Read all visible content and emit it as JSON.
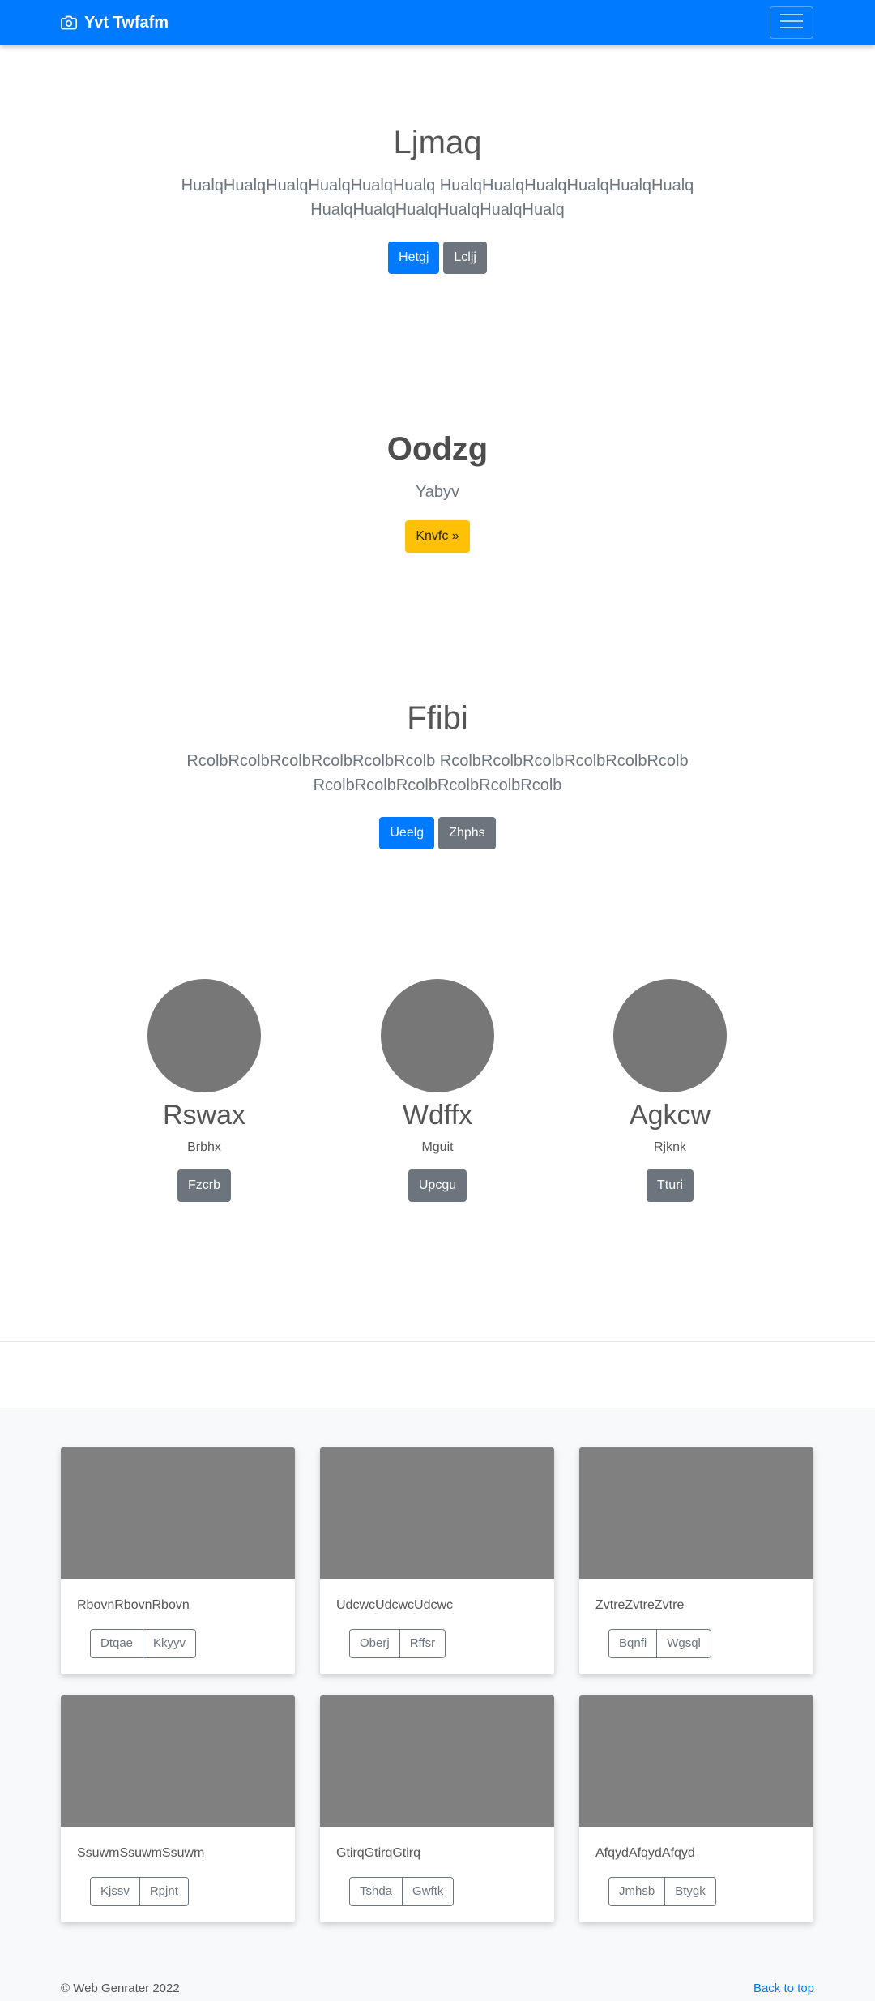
{
  "navbar": {
    "brand": "Yvt Twfafm",
    "brand_icon": "camera-icon",
    "toggler_icon": "hamburger-menu-icon"
  },
  "hero1": {
    "title": "Ljmaq",
    "lead": "HualqHualqHualqHualqHualqHualq HualqHualqHualqHualqHualqHualq HualqHualqHualqHualqHualqHualq",
    "buttons": [
      "Hetgj",
      "Lcljj"
    ]
  },
  "hero2": {
    "title": "Oodzg",
    "subtitle": "Yabyv",
    "button": "Knvfc »"
  },
  "hero3": {
    "title": "Ffibi",
    "lead": "RcolbRcolbRcolbRcolbRcolbRcolb RcolbRcolbRcolbRcolbRcolbRcolb RcolbRcolbRcolbRcolbRcolbRcolb",
    "buttons": [
      "Ueelg",
      "Zhphs"
    ]
  },
  "circles": [
    {
      "name": "Rswax",
      "text": "Brbhx",
      "button": "Fzcrb"
    },
    {
      "name": "Wdffx",
      "text": "Mguit",
      "button": "Upcgu"
    },
    {
      "name": "Agkcw",
      "text": "Rjknk",
      "button": "Tturi"
    }
  ],
  "cards": [
    {
      "text": "RbovnRbovnRbovn",
      "buttons": [
        "Dtqae",
        "Kkyyv"
      ]
    },
    {
      "text": "UdcwcUdcwcUdcwc",
      "buttons": [
        "Oberj",
        "Rffsr"
      ]
    },
    {
      "text": "ZvtreZvtreZvtre",
      "buttons": [
        "Bqnfi",
        "Wgsql"
      ]
    },
    {
      "text": "SsuwmSsuwmSsuwm",
      "buttons": [
        "Kjssv",
        "Rpjnt"
      ]
    },
    {
      "text": "GtirqGtirqGtirq",
      "buttons": [
        "Tshda",
        "Gwftk"
      ]
    },
    {
      "text": "AfqydAfqydAfqyd",
      "buttons": [
        "Jmhsb",
        "Btygk"
      ]
    }
  ],
  "footer": {
    "copyright": "© Web Genrater 2022",
    "back_to_top": "Back to top"
  },
  "colors": {
    "primary": "#007bff",
    "secondary": "#6c757d",
    "warning": "#ffc107",
    "placeholder": "#808080"
  }
}
